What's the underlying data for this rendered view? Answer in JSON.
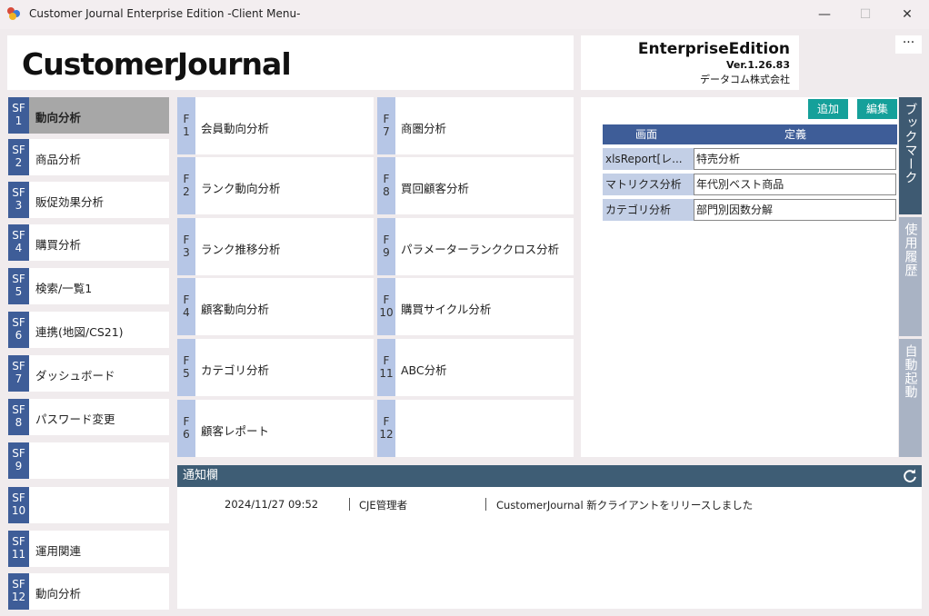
{
  "window": {
    "title": "Customer Journal Enterprise Edition -Client Menu-",
    "minimize": "—",
    "maximize": "☐",
    "close": "✕"
  },
  "header": {
    "brand": "CustomerJournal",
    "edition": "EnterpriseEdition",
    "version": "Ver.1.26.83",
    "company": "データコム株式会社",
    "more": "···"
  },
  "sf_items": [
    {
      "key_top": "SF",
      "key_num": "1",
      "label": "動向分析",
      "active": true
    },
    {
      "key_top": "SF",
      "key_num": "2",
      "label": "商品分析"
    },
    {
      "key_top": "SF",
      "key_num": "3",
      "label": "販促効果分析"
    },
    {
      "key_top": "SF",
      "key_num": "4",
      "label": "購買分析"
    },
    {
      "key_top": "SF",
      "key_num": "5",
      "label": "検索/一覧1"
    },
    {
      "key_top": "SF",
      "key_num": "6",
      "label": "連携(地図/CS21)"
    },
    {
      "key_top": "SF",
      "key_num": "7",
      "label": "ダッシュボード"
    },
    {
      "key_top": "SF",
      "key_num": "8",
      "label": "パスワード変更"
    },
    {
      "key_top": "SF",
      "key_num": "9",
      "label": ""
    },
    {
      "key_top": "SF",
      "key_num": "10",
      "label": ""
    },
    {
      "key_top": "SF",
      "key_num": "11",
      "label": "運用関連"
    },
    {
      "key_top": "SF",
      "key_num": "12",
      "label": "動向分析"
    }
  ],
  "f_items": [
    {
      "key_top": "F",
      "key_num": "1",
      "label": "会員動向分析"
    },
    {
      "key_top": "F",
      "key_num": "2",
      "label": "ランク動向分析"
    },
    {
      "key_top": "F",
      "key_num": "3",
      "label": "ランク推移分析"
    },
    {
      "key_top": "F",
      "key_num": "4",
      "label": "顧客動向分析"
    },
    {
      "key_top": "F",
      "key_num": "5",
      "label": "カテゴリ分析"
    },
    {
      "key_top": "F",
      "key_num": "6",
      "label": "顧客レポート"
    },
    {
      "key_top": "F",
      "key_num": "7",
      "label": "商圏分析"
    },
    {
      "key_top": "F",
      "key_num": "8",
      "label": "買回顧客分析"
    },
    {
      "key_top": "F",
      "key_num": "9",
      "label": "パラメーターランククロス分析"
    },
    {
      "key_top": "F",
      "key_num": "10",
      "label": "購買サイクル分析"
    },
    {
      "key_top": "F",
      "key_num": "11",
      "label": "ABC分析"
    },
    {
      "key_top": "F",
      "key_num": "12",
      "label": ""
    }
  ],
  "bookmark": {
    "add_label": "追加",
    "edit_label": "編集",
    "col_screen": "画面",
    "col_definition": "定義",
    "rows": [
      {
        "screen": "xlsReport[レ...",
        "definition": "特売分析"
      },
      {
        "screen": "マトリクス分析",
        "definition": "年代別ベスト商品"
      },
      {
        "screen": "カテゴリ分析",
        "definition": "部門別因数分解"
      }
    ]
  },
  "side_tabs": {
    "bookmark": "ブックマーク",
    "history": "使用履歴",
    "autostart": "自動起動"
  },
  "notice": {
    "title": "通知欄",
    "items": [
      {
        "datetime": "2024/11/27 09:52",
        "author": "CJE管理者",
        "message": "CustomerJournal 新クライアントをリリースしました"
      }
    ]
  },
  "colors": {
    "sf_key": "#3e5d98",
    "f_key": "#b6c6e6",
    "accent_button": "#15a09a",
    "tab_active": "#3e5a72",
    "tab_inactive": "#a9b3c4"
  }
}
